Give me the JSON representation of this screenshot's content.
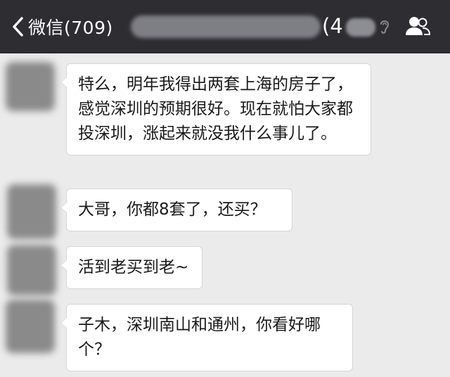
{
  "header": {
    "back_label": "微信(709)",
    "member_count_prefix": "(4"
  },
  "messages": [
    {
      "text": "特么，明年我得出两套上海的房子了，感觉深圳的预期很好。现在就怕大家都投深圳，涨起来就没我什么事儿了。"
    },
    {
      "text": "大哥，你都8套了，还买？"
    },
    {
      "text": "活到老买到老~"
    },
    {
      "text": "子木，深圳南山和通州，你看好哪个？"
    }
  ],
  "icons": {
    "back": "chevron-left-icon",
    "mute": "ear-off-icon",
    "contacts": "group-members-icon"
  },
  "colors": {
    "topbar": "#2d2d32",
    "background": "#ebebeb",
    "bubble": "#ffffff"
  }
}
